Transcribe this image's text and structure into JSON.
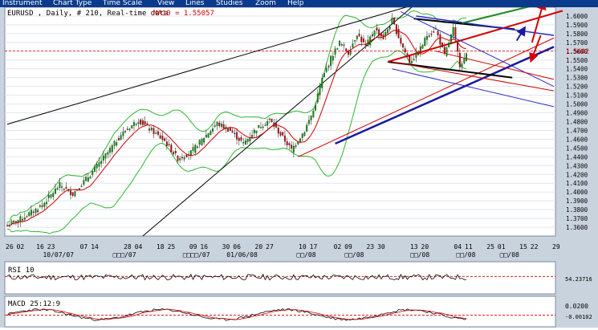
{
  "menu": {
    "items": [
      "Instrument",
      "Chart Type",
      "Time Scale",
      "View",
      "Lines",
      "Studies",
      "Zoom",
      "Help"
    ]
  },
  "price_panel": {
    "title": "EURUSD , Daily, # 210, Real-time data",
    "ma_label": "MA10 = 1.55057"
  },
  "rsi_panel": {
    "label": "RSI 10",
    "value_label": "54.23716"
  },
  "macd_panel": {
    "label": "MACD 25:12:9",
    "value_label": "-0.00102",
    "top_tick": "0.0200"
  },
  "x_axis": {
    "day_labels": [
      {
        "text": "26",
        "dx": 0
      },
      {
        "text": "02",
        "dx": 5
      },
      {
        "text": "16",
        "dx": 14
      },
      {
        "text": "23",
        "dx": 19
      },
      {
        "text": "07",
        "dx": 34
      },
      {
        "text": "14",
        "dx": 39
      },
      {
        "text": "28",
        "dx": 54
      },
      {
        "text": "04",
        "dx": 59
      },
      {
        "text": "18",
        "dx": 69
      },
      {
        "text": "25",
        "dx": 74
      },
      {
        "text": "09",
        "dx": 84
      },
      {
        "text": "16",
        "dx": 89
      },
      {
        "text": "30",
        "dx": 99
      },
      {
        "text": "06",
        "dx": 104
      },
      {
        "text": "20",
        "dx": 114
      },
      {
        "text": "27",
        "dx": 119
      },
      {
        "text": "10",
        "dx": 134
      },
      {
        "text": "17",
        "dx": 139
      },
      {
        "text": "02",
        "dx": 150
      },
      {
        "text": "09",
        "dx": 155
      },
      {
        "text": "23",
        "dx": 165
      },
      {
        "text": "30",
        "dx": 170
      },
      {
        "text": "13",
        "dx": 185
      },
      {
        "text": "20",
        "dx": 190
      },
      {
        "text": "04",
        "dx": 205
      },
      {
        "text": "11",
        "dx": 210
      },
      {
        "text": "25",
        "dx": 220
      },
      {
        "text": "01",
        "dx": 225
      },
      {
        "text": "15",
        "dx": 235
      },
      {
        "text": "22",
        "dx": 240
      },
      {
        "text": "29",
        "dx": 250
      }
    ],
    "period_labels": [
      {
        "text": "10/07/07",
        "dx": 20
      },
      {
        "text": "□□□/07",
        "dx": 52
      },
      {
        "text": "□□□□/07",
        "dx": 84
      },
      {
        "text": "01/06/08",
        "dx": 104
      },
      {
        "text": "□□/08",
        "dx": 136
      },
      {
        "text": "□□/08",
        "dx": 158
      },
      {
        "text": "□□/08",
        "dx": 188
      },
      {
        "text": "□□/08",
        "dx": 209
      },
      {
        "text": "□□/08",
        "dx": 229
      }
    ]
  },
  "chart_data": {
    "type": "candlestick",
    "symbol": "EURUSD",
    "interval": "Daily",
    "bars": 210,
    "title": "EURUSD , Daily, # 210, Real-time data",
    "ma10_last": 1.55057,
    "ylim": [
      1.35,
      1.61
    ],
    "y_ticks": [
      "1.6000",
      "1.5900",
      "1.5800",
      "1.5700",
      "1.5600",
      "1.5500",
      "1.5400",
      "1.5300",
      "1.5200",
      "1.5100",
      "1.5000",
      "1.4900",
      "1.4800",
      "1.4700",
      "1.4600",
      "1.4500",
      "1.4400",
      "1.4300",
      "1.4200",
      "1.4100",
      "1.4000",
      "1.3900",
      "1.3800",
      "1.3700",
      "1.3600"
    ],
    "current_price_label": "1.5602",
    "anchors": [
      [
        0,
        1.362
      ],
      [
        8,
        1.372
      ],
      [
        16,
        1.385
      ],
      [
        24,
        1.408
      ],
      [
        30,
        1.398
      ],
      [
        38,
        1.42
      ],
      [
        46,
        1.445
      ],
      [
        52,
        1.465
      ],
      [
        60,
        1.482
      ],
      [
        66,
        1.47
      ],
      [
        72,
        1.458
      ],
      [
        78,
        1.438
      ],
      [
        84,
        1.445
      ],
      [
        90,
        1.462
      ],
      [
        96,
        1.478
      ],
      [
        102,
        1.47
      ],
      [
        108,
        1.455
      ],
      [
        114,
        1.472
      ],
      [
        120,
        1.482
      ],
      [
        126,
        1.462
      ],
      [
        130,
        1.448
      ],
      [
        136,
        1.47
      ],
      [
        140,
        1.492
      ],
      [
        144,
        1.528
      ],
      [
        148,
        1.552
      ],
      [
        152,
        1.57
      ],
      [
        156,
        1.558
      ],
      [
        160,
        1.58
      ],
      [
        164,
        1.565
      ],
      [
        168,
        1.585
      ],
      [
        172,
        1.575
      ],
      [
        176,
        1.595
      ],
      [
        180,
        1.57
      ],
      [
        184,
        1.548
      ],
      [
        188,
        1.558
      ],
      [
        192,
        1.578
      ],
      [
        196,
        1.585
      ],
      [
        200,
        1.555
      ],
      [
        204,
        1.585
      ],
      [
        207,
        1.545
      ],
      [
        210,
        1.555
      ]
    ],
    "ma_color": "#cc0000",
    "bull_color": "#00a000",
    "bear_color": "#d40000",
    "bollinger_color": "#2fb62f",
    "lines": [
      {
        "color": "#000000",
        "width": 1,
        "from": [
          0,
          1.477
        ],
        "to": [
          185,
          1.612
        ]
      },
      {
        "color": "#000000",
        "width": 1,
        "from": [
          62,
          1.35
        ],
        "to": [
          185,
          1.61
        ]
      },
      {
        "color": "#d40000",
        "width": 1,
        "from": [
          133,
          1.44
        ],
        "to": [
          250,
          1.575
        ]
      },
      {
        "color": "#1a1aa0",
        "width": 2.5,
        "from": [
          150,
          1.455
        ],
        "to": [
          250,
          1.565
        ]
      },
      {
        "color": "#000000",
        "width": 2,
        "from": [
          174,
          1.548
        ],
        "to": [
          231,
          1.53
        ]
      },
      {
        "color": "#000000",
        "width": 2,
        "from": [
          186,
          1.597
        ],
        "to": [
          232,
          1.585
        ]
      },
      {
        "color": "#d40000",
        "width": 2,
        "from": [
          174,
          1.548
        ],
        "to": [
          254,
          1.606
        ]
      },
      {
        "color": "#2a2ad0",
        "width": 1.5,
        "from": [
          187,
          1.6
        ],
        "to": [
          250,
          1.578
        ]
      },
      {
        "color": "#2a2ad0",
        "width": 1,
        "from": [
          176,
          1.54
        ],
        "to": [
          250,
          1.497
        ]
      },
      {
        "color": "#2a2ad0",
        "width": 1,
        "from": [
          180,
          1.605
        ],
        "to": [
          250,
          1.52
        ]
      },
      {
        "color": "#d40000",
        "width": 1,
        "from": [
          176,
          1.548
        ],
        "to": [
          250,
          1.515
        ]
      },
      {
        "color": "#d40000",
        "width": 1,
        "from": [
          196,
          1.56
        ],
        "to": [
          250,
          1.528
        ]
      },
      {
        "color": "#1f8a1f",
        "width": 2,
        "from": [
          208,
          1.592
        ],
        "to": [
          254,
          1.62
        ]
      }
    ],
    "arrows": [
      {
        "color": "#d40000",
        "from": [
          240,
          1.57
        ],
        "to": [
          245,
          1.613
        ]
      },
      {
        "color": "#d40000",
        "from": [
          244,
          1.578
        ],
        "to": [
          240,
          1.552
        ]
      },
      {
        "color": "#1a1aa0",
        "from": [
          233,
          1.572
        ],
        "to": [
          236,
          1.584
        ]
      }
    ],
    "rsi": {
      "label": "RSI 10",
      "last": 54.23716,
      "range": [
        0,
        100
      ],
      "level": 54.23716
    },
    "macd": {
      "label": "MACD 25:12:9",
      "last": -0.00102,
      "range": [
        -0.02,
        0.03
      ],
      "top_tick": 0.02
    }
  }
}
